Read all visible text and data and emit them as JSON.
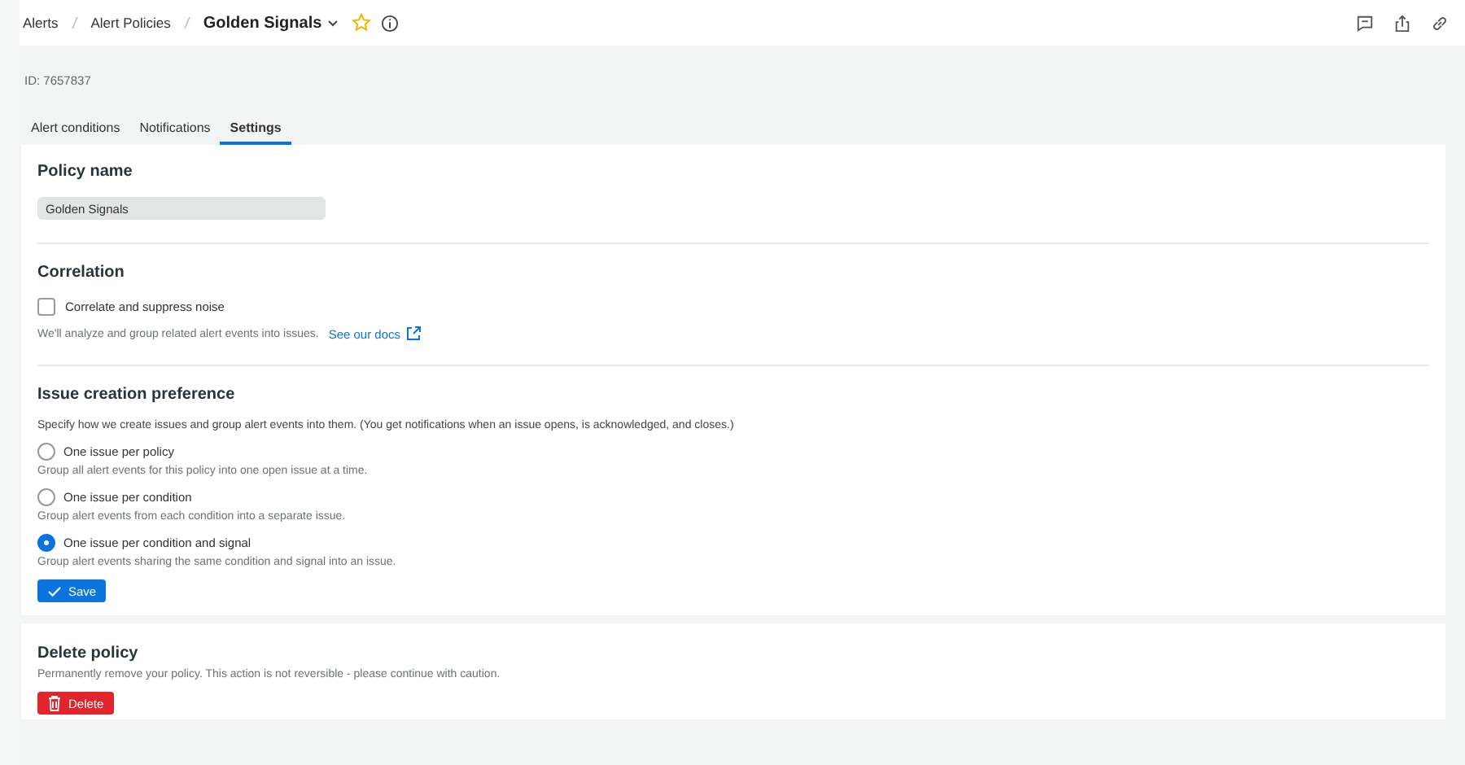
{
  "breadcrumbs": [
    "Alerts",
    "Alert Policies"
  ],
  "title": "Golden Signals",
  "favorite": false,
  "id_label": "ID: 7657837",
  "tabs": [
    {
      "label": "Alert conditions",
      "selected": false
    },
    {
      "label": "Notifications",
      "selected": false
    },
    {
      "label": "Settings",
      "selected": true
    }
  ],
  "policy_name": {
    "heading": "Policy name",
    "value": "Golden Signals"
  },
  "correlation": {
    "heading": "Correlation",
    "checkbox_label": "Correlate and suppress noise",
    "checked": false,
    "description": "We'll analyze and group related alert events into issues.",
    "link": "See our docs"
  },
  "issue_creation": {
    "heading": "Issue creation preference",
    "description": "Specify how we create issues and group alert events into them. (You get notifications when an issue opens, is acknowledged, and closes.)",
    "options": [
      {
        "label": "One issue per policy",
        "hint": "Group all alert events for this policy into one open issue at a time.",
        "selected": false
      },
      {
        "label": "One issue per condition",
        "hint": "Group alert events from each condition into a separate issue.",
        "selected": false
      },
      {
        "label": "One issue per condition and signal",
        "hint": "Group alert events sharing the same condition and signal into an issue.",
        "selected": true
      }
    ],
    "save_button": "Save"
  },
  "delete_policy": {
    "heading": "Delete policy",
    "description": "Permanently remove your policy. This action is not reversible - please continue with caution.",
    "button": "Delete"
  }
}
